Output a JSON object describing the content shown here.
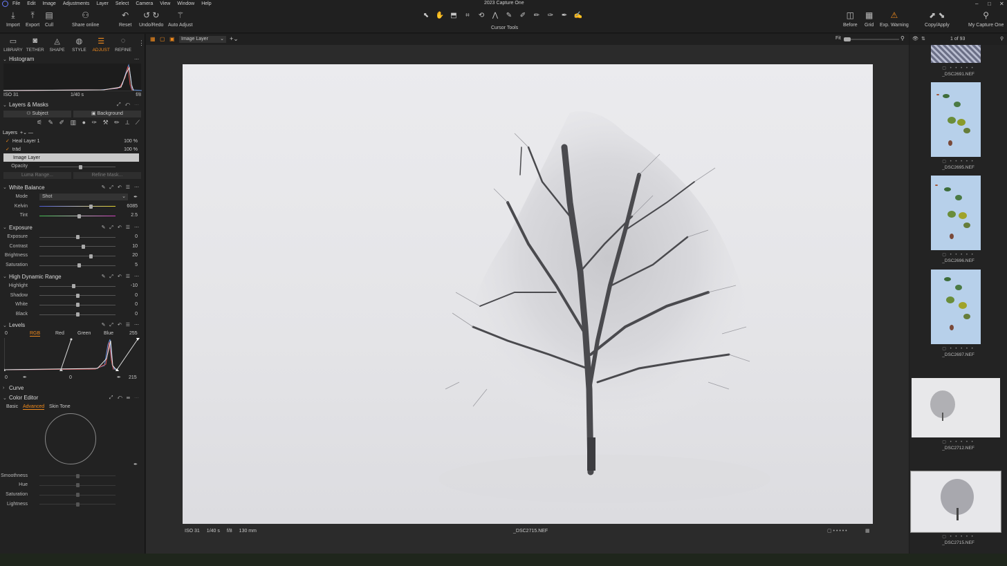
{
  "app": {
    "title": "2023 Capture One"
  },
  "menu": [
    "File",
    "Edit",
    "Image",
    "Adjustments",
    "Layer",
    "Select",
    "Camera",
    "View",
    "Window",
    "Help"
  ],
  "toolbar": {
    "import": "Import",
    "export": "Export",
    "cull": "Cull",
    "share": "Share online",
    "reset": "Reset",
    "undo_redo": "Undo/Redo",
    "auto_adjust": "Auto Adjust",
    "cursor_tools": "Cursor Tools",
    "before": "Before",
    "grid": "Grid",
    "exp_warning": "Exp. Warning",
    "copy_apply": "Copy/Apply",
    "my_capture": "My Capture One"
  },
  "tool_tabs": [
    "LIBRARY",
    "TETHER",
    "SHAPE",
    "STYLE",
    "ADJUST",
    "REFINE"
  ],
  "active_tab": "ADJUST",
  "histogram": {
    "title": "Histogram",
    "iso": "ISO 31",
    "shutter": "1/40 s",
    "aperture": "f/8"
  },
  "layers_masks": {
    "title": "Layers & Masks",
    "subject": "Subject",
    "background": "Background",
    "layers_label": "Layers",
    "layers": [
      {
        "name": "Heal Layer 1",
        "opacity": "100 %"
      },
      {
        "name": "träd",
        "opacity": "100 %"
      },
      {
        "name": "Image Layer",
        "opacity": ""
      }
    ],
    "opacity_label": "Opacity",
    "luma_range": "Luma Range...",
    "refine_mask": "Refine Mask..."
  },
  "white_balance": {
    "title": "White Balance",
    "mode_label": "Mode",
    "mode_value": "Shot",
    "kelvin_label": "Kelvin",
    "kelvin": "6085",
    "kelvin_pos": 0.68,
    "tint_label": "Tint",
    "tint": "2.5",
    "tint_pos": 0.52
  },
  "exposure": {
    "title": "Exposure",
    "rows": [
      {
        "label": "Exposure",
        "value": "0",
        "pos": 0.5
      },
      {
        "label": "Contrast",
        "value": "10",
        "pos": 0.58
      },
      {
        "label": "Brightness",
        "value": "20",
        "pos": 0.68
      },
      {
        "label": "Saturation",
        "value": "5",
        "pos": 0.52
      }
    ]
  },
  "hdr": {
    "title": "High Dynamic Range",
    "rows": [
      {
        "label": "Highlight",
        "value": "-10",
        "pos": 0.45
      },
      {
        "label": "Shadow",
        "value": "0",
        "pos": 0.5
      },
      {
        "label": "White",
        "value": "0",
        "pos": 0.5
      },
      {
        "label": "Black",
        "value": "0",
        "pos": 0.5
      }
    ]
  },
  "levels": {
    "title": "Levels",
    "low": "0",
    "high": "255",
    "tabs": [
      "RGB",
      "Red",
      "Green",
      "Blue"
    ],
    "active": "RGB",
    "out_low": "0",
    "mid": "0",
    "out_high": "215"
  },
  "curve": {
    "title": "Curve"
  },
  "color_editor": {
    "title": "Color Editor",
    "tabs": [
      "Basic",
      "Advanced",
      "Skin Tone"
    ],
    "active": "Advanced",
    "rows": [
      "Smoothness",
      "Hue",
      "Saturation",
      "Lightness"
    ]
  },
  "viewer": {
    "layer_select": "Image Layer",
    "iso": "ISO 31",
    "shutter": "1/40 s",
    "aperture": "f/8",
    "focal": "130 mm",
    "filename": "_DSC2715.NEF"
  },
  "filmstrip": {
    "fit": "Fit",
    "counter": "1 of 93",
    "thumbs": [
      {
        "name": "_DSC2691.NEF"
      },
      {
        "name": "_DSC2695.NEF"
      },
      {
        "name": "_DSC2696.NEF"
      },
      {
        "name": "_DSC2697.NEF"
      },
      {
        "name": "_DSC2712.NEF"
      },
      {
        "name": "_DSC2715.NEF"
      }
    ]
  },
  "colors": {
    "accent": "#f08a1d",
    "panel": "#222222",
    "bg": "#1b1b1b"
  }
}
